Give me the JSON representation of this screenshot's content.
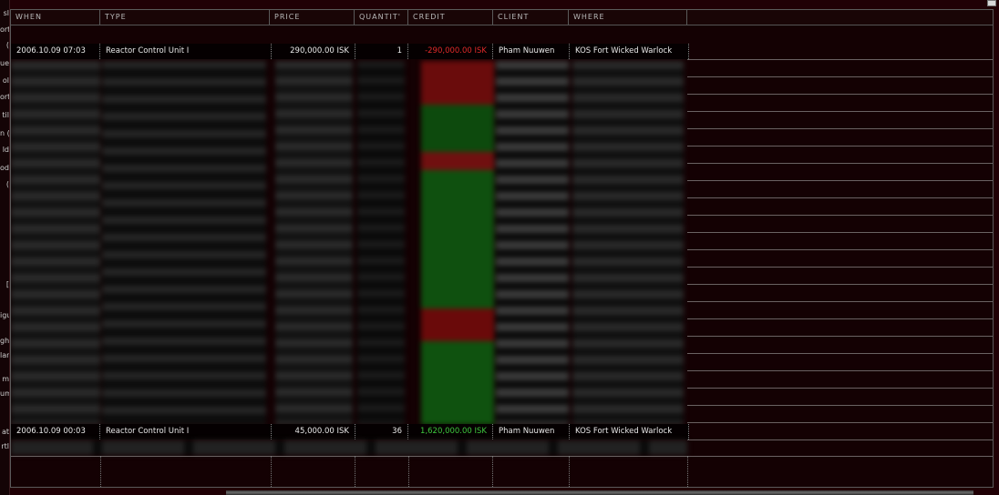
{
  "left_fragments": [
    "sl",
    "ort",
    "(",
    "ue",
    "ol",
    "ort",
    "til",
    "n (",
    "ld",
    "od",
    "(",
    "[",
    "igu",
    "ght",
    "lan",
    "m",
    "um",
    "at",
    "rtl"
  ],
  "headers": {
    "when": "WHEN",
    "type": "TYPE",
    "price": "PRICE",
    "quantity": "QUANTIT'",
    "credit": "CREDIT",
    "client": "CLIENT",
    "where": "WHERE"
  },
  "rows": [
    {
      "when": "2006.10.09 07:03",
      "type": "Reactor Control Unit I",
      "price": "290,000.00 ISK",
      "quantity": "1",
      "credit": "-290,000.00 ISK",
      "credit_color": "#e02a2a",
      "client": "Pham Nuuwen",
      "where": "KOS Fort Wicked Warlock"
    },
    {
      "when": "2006.10.09 00:03",
      "type": "Reactor Control Unit I",
      "price": "45,000.00 ISK",
      "quantity": "36",
      "credit": "1,620,000.00 ISK",
      "credit_color": "#3ec83e",
      "client": "Pham Nuuwen",
      "where": "KOS Fort Wicked Warlock"
    }
  ]
}
